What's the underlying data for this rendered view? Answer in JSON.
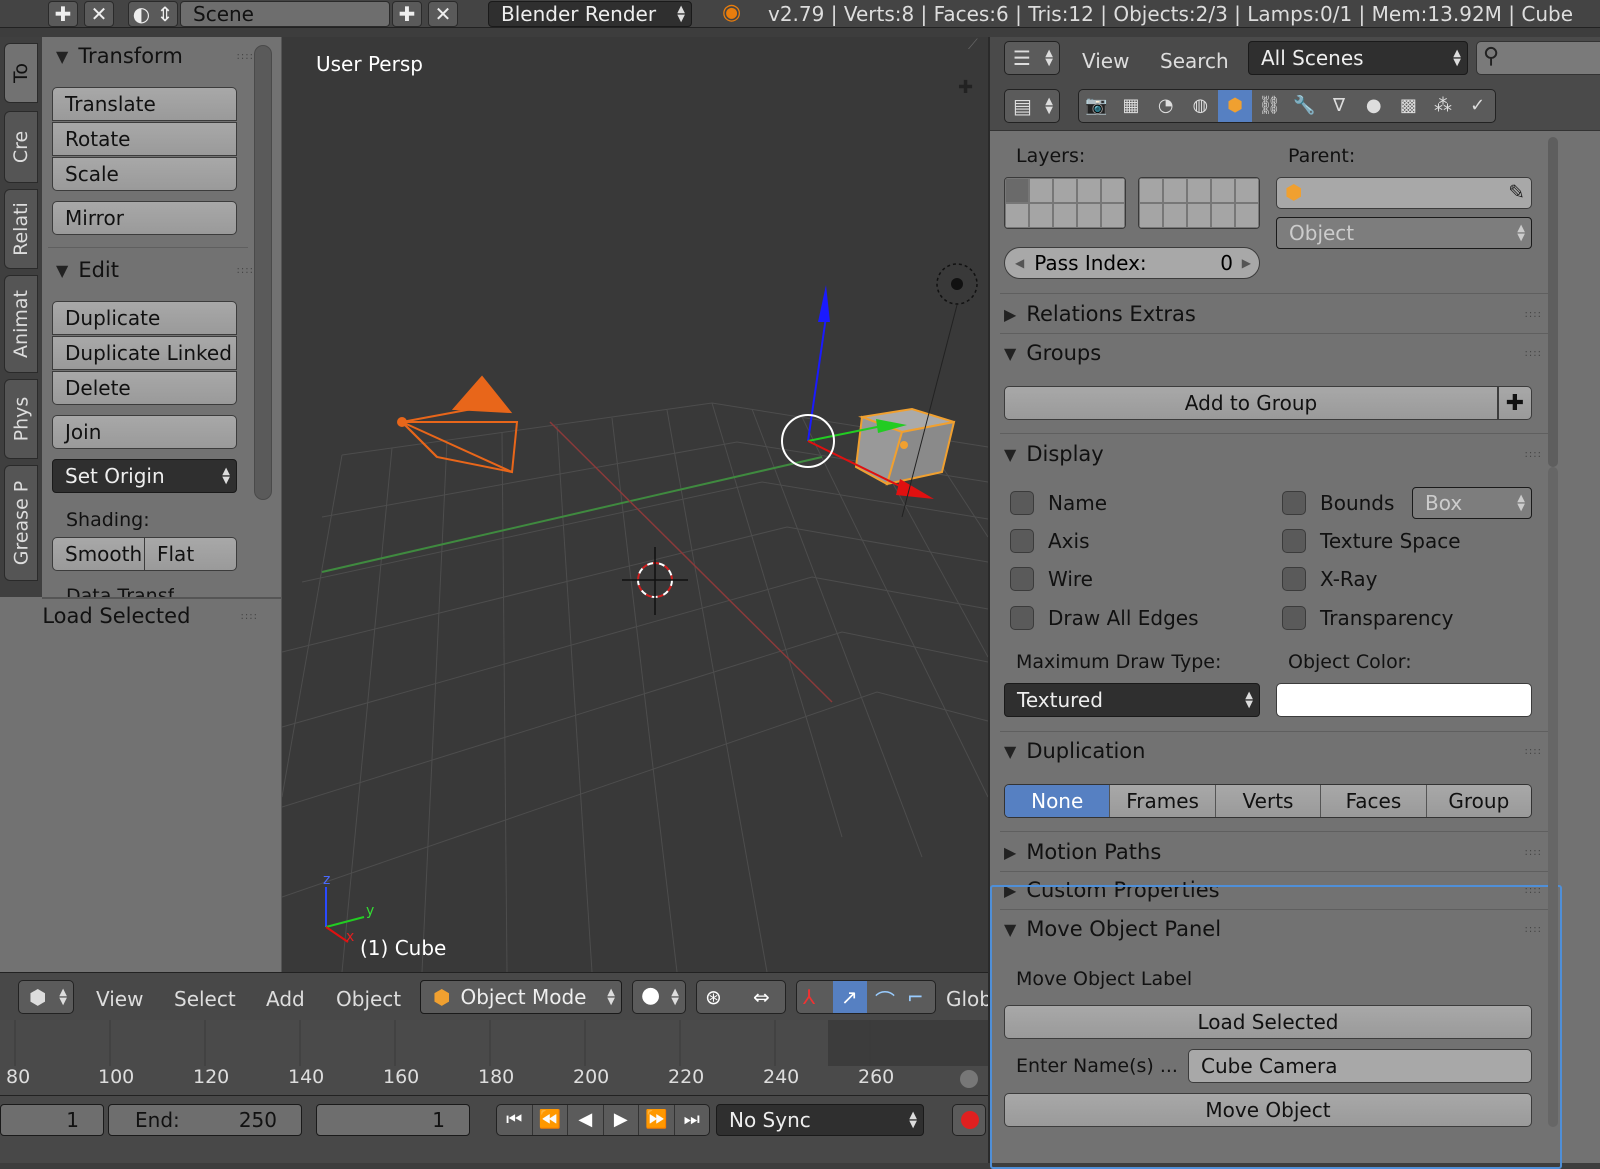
{
  "topbar": {
    "scene_field": "Scene",
    "render_engine": "Blender Render",
    "status": "v2.79 | Verts:8 | Faces:6 | Tris:12 | Objects:2/3 | Lamps:0/1 | Mem:13.92M | Cube"
  },
  "tool_tabs": [
    "To",
    "Cre",
    "Relati",
    "Animat",
    "Phys",
    "Grease P"
  ],
  "shelf": {
    "transform_title": "Transform",
    "transform_buttons": [
      "Translate",
      "Rotate",
      "Scale"
    ],
    "mirror": "Mirror",
    "edit_title": "Edit",
    "edit_buttons": [
      "Duplicate",
      "Duplicate Linked",
      "Delete"
    ],
    "join": "Join",
    "set_origin": "Set Origin",
    "shading_label": "Shading:",
    "smooth": "Smooth",
    "flat": "Flat",
    "cut_text": "Data Transf",
    "load_selected_title": "Load Selected"
  },
  "viewport": {
    "view_label": "User Persp",
    "object_label": "(1) Cube",
    "axis_z": "z",
    "axis_y": "y",
    "axis_x": "x"
  },
  "view_header": {
    "menus": [
      "View",
      "Select",
      "Add",
      "Object"
    ],
    "mode": "Object Mode",
    "orientation": "Glob"
  },
  "timeline": {
    "ticks": [
      "80",
      "100",
      "120",
      "140",
      "160",
      "180",
      "200",
      "220",
      "240",
      "260"
    ],
    "start_value": "1",
    "end_label": "End:",
    "end_value": "250",
    "current_frame": "1",
    "sync": "No Sync"
  },
  "properties": {
    "header_menus": [
      "View",
      "Search"
    ],
    "scenes_dropdown": "All Scenes",
    "layers_label": "Layers:",
    "parent_label": "Parent:",
    "parent_type": "Object",
    "pass_index_label": "Pass Index:",
    "pass_index_value": "0",
    "relations_extras": "Relations Extras",
    "groups": "Groups",
    "add_to_group": "Add to Group",
    "display": "Display",
    "display_left": [
      "Name",
      "Axis",
      "Wire",
      "Draw All Edges"
    ],
    "display_right": [
      "Bounds",
      "Texture Space",
      "X-Ray",
      "Transparency"
    ],
    "bounds_type": "Box",
    "max_draw_type_label": "Maximum Draw Type:",
    "max_draw_type": "Textured",
    "object_color_label": "Object Color:",
    "duplication": "Duplication",
    "duplication_options": [
      "None",
      "Frames",
      "Verts",
      "Faces",
      "Group"
    ],
    "motion_paths": "Motion Paths",
    "custom_properties": "Custom Properties",
    "move_object_panel": "Move Object Panel",
    "move_object_label": "Move Object Label",
    "load_selected_button": "Load Selected",
    "enter_names_label": "Enter Name(s) ...",
    "enter_names_value": "Cube Camera",
    "move_object_button": "Move Object"
  },
  "colors": {
    "accent_blue": "#5680c2",
    "panel_gray": "#727272",
    "viewport_bg": "#393939",
    "camera_orange": "#e8661a",
    "highlight_outline": "#4f8fd8"
  }
}
